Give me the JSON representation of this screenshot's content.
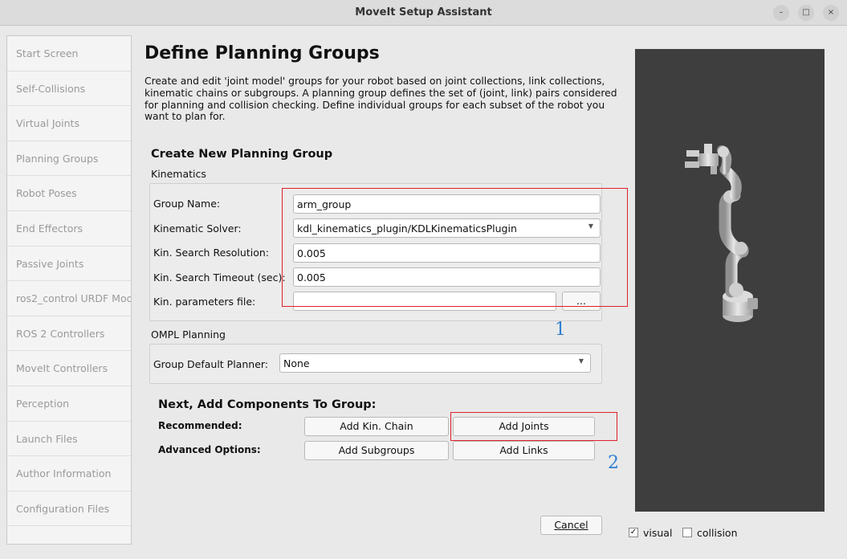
{
  "window": {
    "title": "MoveIt Setup Assistant"
  },
  "window_controls": {
    "minimize": "–",
    "maximize": "□",
    "close": "×"
  },
  "sidebar": {
    "items": [
      "Start Screen",
      "Self-Collisions",
      "Virtual Joints",
      "Planning Groups",
      "Robot Poses",
      "End Effectors",
      "Passive Joints",
      "ros2_control URDF Mod",
      "ROS 2 Controllers",
      "MoveIt Controllers",
      "Perception",
      "Launch Files",
      "Author Information",
      "Configuration Files"
    ]
  },
  "page": {
    "title": "Define Planning Groups",
    "description": "Create and edit 'joint model' groups for your robot based on joint collections, link collections, kinematic chains or subgroups. A planning group defines the set of (joint, link) pairs considered for planning and collision checking. Define individual groups for each subset of the robot you want to plan for."
  },
  "create_group": {
    "heading": "Create New Planning Group",
    "kinematics_label": "Kinematics",
    "group_name_label": "Group Name:",
    "group_name_value": "arm_group",
    "solver_label": "Kinematic Solver:",
    "solver_value": "kdl_kinematics_plugin/KDLKinematicsPlugin",
    "resolution_label": "Kin. Search Resolution:",
    "resolution_value": "0.005",
    "timeout_label": "Kin. Search Timeout (sec):",
    "timeout_value": "0.005",
    "params_label": "Kin. parameters file:",
    "params_value": "",
    "browse_label": "...",
    "ompl_label": "OMPL Planning",
    "planner_label": "Group Default Planner:",
    "planner_value": "None"
  },
  "components": {
    "heading": "Next, Add Components To Group:",
    "recommended_label": "Recommended:",
    "advanced_label": "Advanced Options:",
    "add_kin_chain": "Add Kin. Chain",
    "add_joints": "Add Joints",
    "add_subgroups": "Add Subgroups",
    "add_links": "Add Links"
  },
  "footer": {
    "cancel": "Cancel"
  },
  "annotations": {
    "one": "1",
    "two": "2"
  },
  "viewer": {
    "visual_label": "visual",
    "visual_checked": true,
    "collision_label": "collision",
    "collision_checked": false
  },
  "colors": {
    "highlight": "#e0202a",
    "annotation": "#2f7fd0",
    "viewer_bg": "#3e3e3e"
  }
}
